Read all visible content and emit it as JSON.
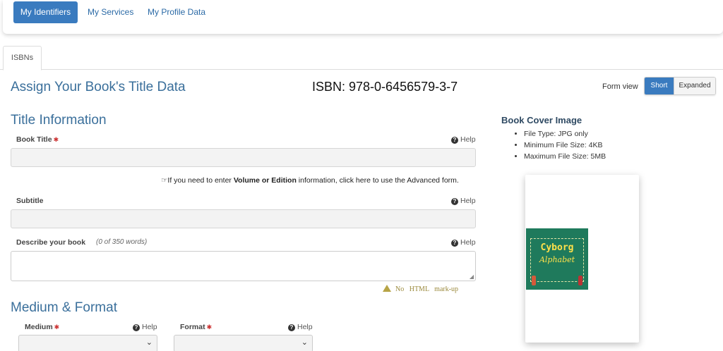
{
  "nav": {
    "identifiers": "My Identifiers",
    "services": "My Services",
    "profile": "My Profile Data"
  },
  "tabs": [
    "ISBNs"
  ],
  "header": {
    "title": "Assign Your Book's Title Data",
    "isbn": "ISBN: 978-0-6456579-3-7",
    "form_view_label": "Form view",
    "form_view_options": [
      "Short",
      "Expanded"
    ],
    "form_view_selected": "Short"
  },
  "title_info": {
    "heading": "Title Information",
    "book_title_label": "Book Title",
    "book_title_value": "",
    "help": "Help",
    "advanced_note_pre": "If you need to enter ",
    "advanced_note_bold": "Volume or Edition",
    "advanced_note_post": " information, click here to use the Advanced form.",
    "subtitle_label": "Subtitle",
    "subtitle_value": "",
    "describe_label": "Describe your book",
    "word_count": "(0 of 350 words)",
    "describe_value": "",
    "no_html": "No   HTML   mark-up"
  },
  "medium_format": {
    "heading": "Medium & Format",
    "medium_label": "Medium",
    "format_label": "Format",
    "medium_value": "",
    "format_value": ""
  },
  "cover": {
    "heading": "Book Cover Image",
    "requirements": [
      "File Type: JPG only",
      "Minimum File Size: 4KB",
      "Maximum File Size: 5MB"
    ],
    "book_title_line1": "Cyborg",
    "book_title_line2": "Alphabet"
  },
  "colors": {
    "accent": "#3a7bbf",
    "heading": "#3a6f9b",
    "warning": "#b7a446"
  }
}
